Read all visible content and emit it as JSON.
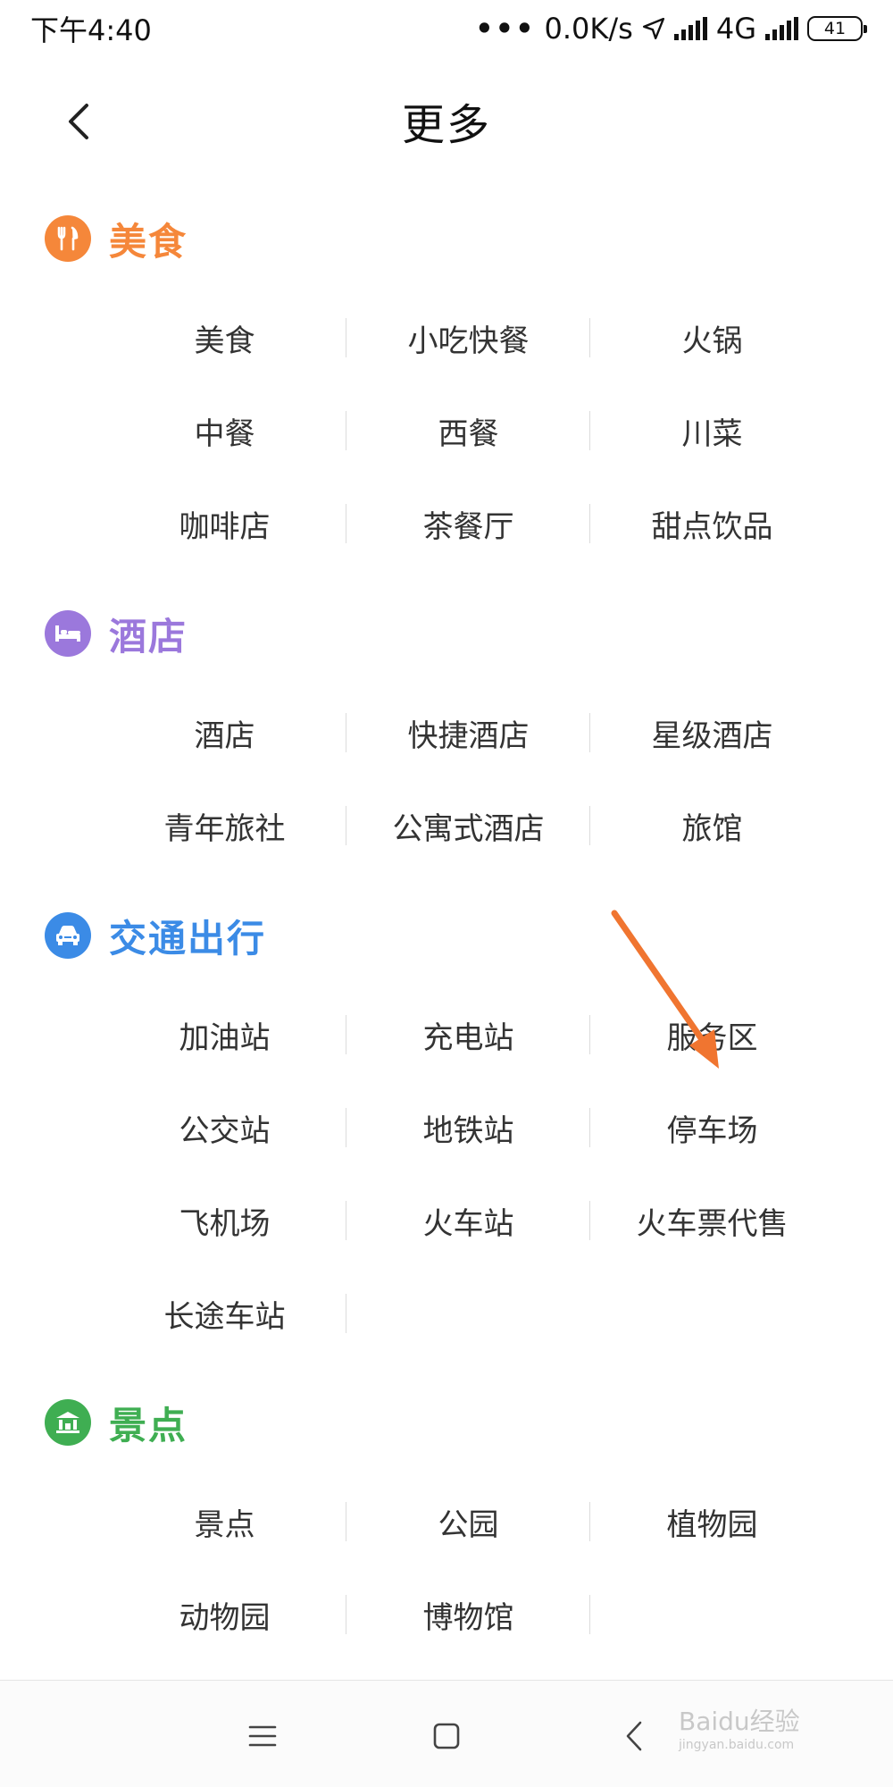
{
  "status_bar": {
    "time": "下午4:40",
    "speed": "0.0K/s",
    "network": "4G",
    "battery": "41"
  },
  "header": {
    "title": "更多"
  },
  "sections": [
    {
      "title": "美食",
      "color": "#f5873a",
      "icon": "utensils-icon",
      "rows": [
        [
          "美食",
          "小吃快餐",
          "火锅"
        ],
        [
          "中餐",
          "西餐",
          "川菜"
        ],
        [
          "咖啡店",
          "茶餐厅",
          "甜点饮品"
        ]
      ]
    },
    {
      "title": "酒店",
      "color": "#9b78dc",
      "icon": "bed-icon",
      "rows": [
        [
          "酒店",
          "快捷酒店",
          "星级酒店"
        ],
        [
          "青年旅社",
          "公寓式酒店",
          "旅馆"
        ]
      ]
    },
    {
      "title": "交通出行",
      "color": "#3b8be6",
      "icon": "car-icon",
      "rows": [
        [
          "加油站",
          "充电站",
          "服务区"
        ],
        [
          "公交站",
          "地铁站",
          "停车场"
        ],
        [
          "飞机场",
          "火车站",
          "火车票代售"
        ],
        [
          "长途车站"
        ]
      ]
    },
    {
      "title": "景点",
      "color": "#3fae52",
      "icon": "landmark-icon",
      "rows": [
        [
          "景点",
          "公园",
          "植物园"
        ],
        [
          "动物园",
          "博物馆"
        ]
      ]
    }
  ],
  "watermark": {
    "text": "Baidu经验",
    "sub": "jingyan.baidu.com"
  },
  "colors": {
    "annotation_arrow": "#f07530"
  }
}
